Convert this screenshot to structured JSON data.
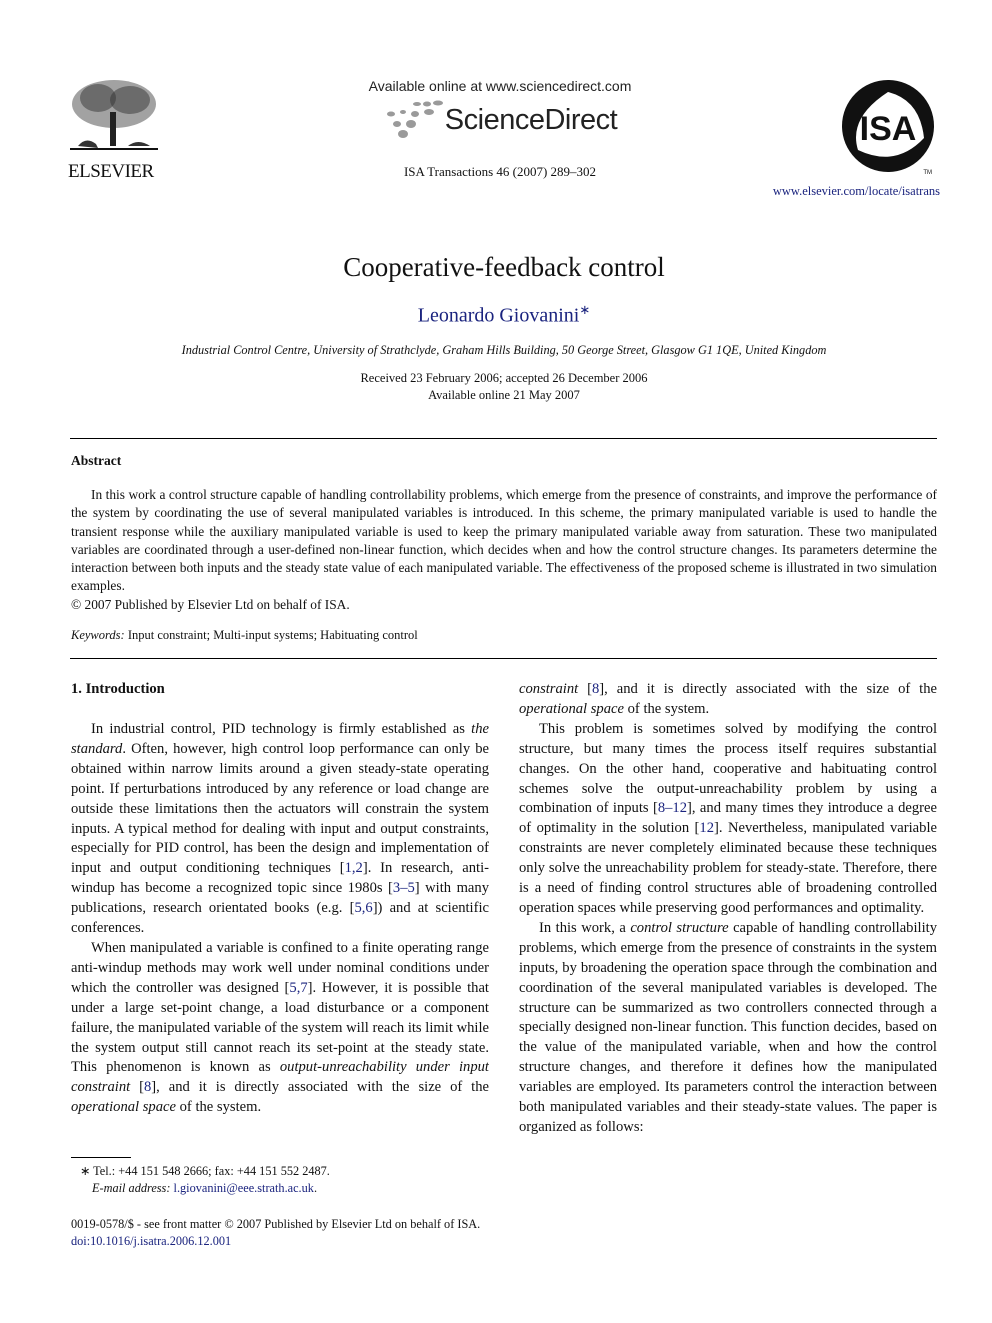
{
  "header": {
    "publisher": "ELSEVIER",
    "available_online": "Available online at www.sciencedirect.com",
    "sciencedirect": "ScienceDirect",
    "journal_ref": "ISA Transactions 46 (2007) 289–302",
    "isa_logo_text": "ISA",
    "isa_tm": "TM",
    "journal_url": "www.elsevier.com/locate/isatrans"
  },
  "article": {
    "title": "Cooperative-feedback control",
    "author": "Leonardo Giovanini",
    "author_mark": "∗",
    "affiliation": "Industrial Control Centre, University of Strathclyde, Graham Hills Building, 50 George Street, Glasgow G1 1QE, United Kingdom",
    "received": "Received 23 February 2006; accepted 26 December 2006",
    "available": "Available online 21 May 2007"
  },
  "abstract": {
    "heading": "Abstract",
    "text": "In this work a control structure capable of handling controllability problems, which emerge from the presence of constraints, and improve the performance of the system by coordinating the use of several manipulated variables is introduced. In this scheme, the primary manipulated variable is used to handle the transient response while the auxiliary manipulated variable is used to keep the primary manipulated variable away from saturation. These two manipulated variables are coordinated through a user-defined non-linear function, which decides when and how the control structure changes. Its parameters determine the interaction between both inputs and the steady state value of each manipulated variable. The effectiveness of the proposed scheme is illustrated in two simulation examples.",
    "copyright": "© 2007 Published by Elsevier Ltd on behalf of ISA.",
    "keywords_label": "Keywords:",
    "keywords": "Input constraint; Multi-input systems; Habituating control"
  },
  "intro": {
    "heading": "1.  Introduction",
    "p1_a": "In industrial control, PID technology is firmly established as ",
    "p1_em": "the standard",
    "p1_b": ". Often, however, high control loop performance can only be obtained within narrow limits around a given steady-state operating point. If perturbations introduced by any reference or load change are outside these limitations then the actuators will constrain the system inputs. A typical method for dealing with input and output constraints, especially for PID control, has been the design and implementation of input and output conditioning techniques [",
    "ref_1_2": "1,2",
    "p1_c": "]. In research, anti-windup has become a recognized topic since 1980s [",
    "ref_3_5": "3–5",
    "p1_d": "] with many publications, research orientated books (e.g. [",
    "ref_5_6": "5,6",
    "p1_e": "]) and at scientific conferences.",
    "p2_a": "When manipulated a variable is confined to a finite operating range anti-windup methods may work well under nominal conditions under which the controller was designed [",
    "ref_5_7": "5,7",
    "p2_b": "]. However, it is possible that under a large set-point change, a load disturbance or a component failure, the manipulated variable of the system will reach its limit while the system output still cannot reach its set-point at the steady state. This phenomenon is known as ",
    "p2_em": "output-unreachability under input constraint",
    "p2_c": " [",
    "ref_8": "8",
    "p2_d": "], and it is directly associated with the size of the ",
    "p2_em2": "operational space",
    "p2_e": " of the system.",
    "p3_a": "This problem is sometimes solved by modifying the control structure, but many times the process itself requires substantial changes. On the other hand, cooperative and habituating control schemes solve the output-unreachability problem by using a combination of inputs [",
    "ref_8_12": "8–12",
    "p3_b": "], and many times they introduce a degree of optimality in the solution [",
    "ref_12": "12",
    "p3_c": "]. Nevertheless, manipulated variable constraints are never completely eliminated because these techniques only solve the unreachability problem for steady-state. Therefore, there is a need of finding control structures able of broadening controlled operation spaces while preserving good performances and optimality.",
    "p4_a": "In this work, a ",
    "p4_em": "control structure",
    "p4_b": " capable of handling controllability problems, which emerge from the presence of constraints in the system inputs, by broadening the operation space through the combination and coordination of the several manipulated variables is developed. The structure can be summarized as two controllers connected through a specially designed non-linear function. This function decides, based on the value of the manipulated variable, when and how the control structure changes, and therefore it defines how the manipulated variables are employed.  Its parameters control the interaction between both manipulated variables and their steady-state values. The paper is organized as follows:"
  },
  "footnote": {
    "tel": "∗ Tel.: +44 151 548 2666; fax: +44 151 552 2487.",
    "email_label": "E-mail address:",
    "email": "l.giovanini@eee.strath.ac.uk",
    "email_end": "."
  },
  "footer": {
    "front_matter": "0019-0578/$ - see front matter © 2007 Published by Elsevier Ltd on behalf of ISA.",
    "doi": "doi:10.1016/j.isatra.2006.12.001"
  },
  "colors": {
    "link": "#1a237e",
    "text": "#111111"
  }
}
